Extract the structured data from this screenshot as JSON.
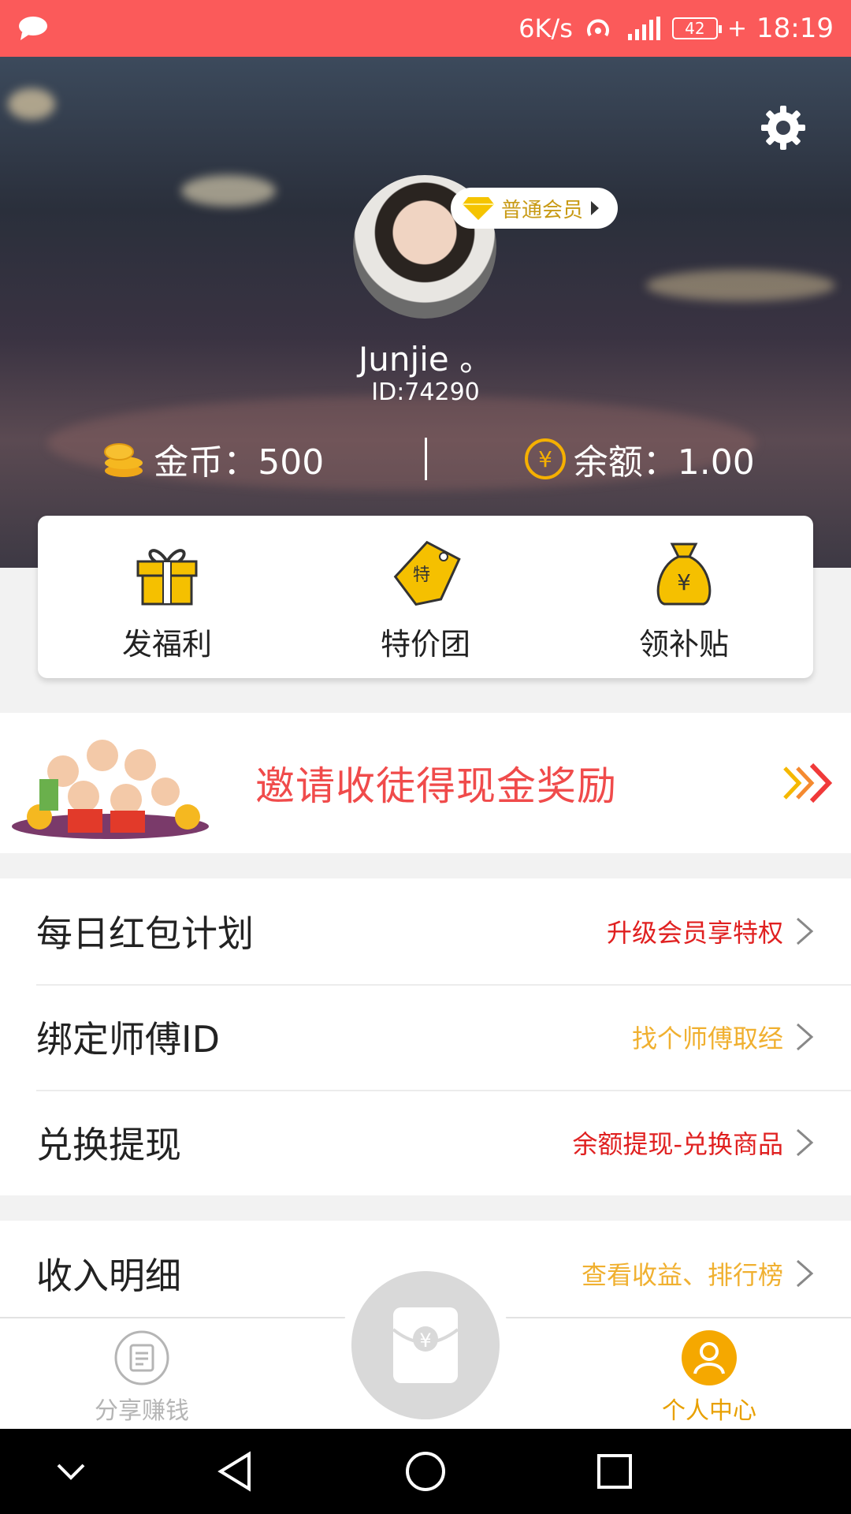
{
  "status_bar": {
    "speed": "6K/s",
    "battery": "42",
    "time": "18:19"
  },
  "profile": {
    "member_badge": "普通会员",
    "username": "Junjie 。",
    "user_id": "ID:74290",
    "coins": "金币：500",
    "balance": "余额：1.00"
  },
  "quick_actions": [
    {
      "label": "发福利",
      "icon": "gift-icon"
    },
    {
      "label": "特价团",
      "icon": "price-tag-icon"
    },
    {
      "label": "领补贴",
      "icon": "money-bag-icon"
    }
  ],
  "invite_banner": {
    "text": "邀请收徒得现金奖励"
  },
  "menu": [
    {
      "title": "每日红包计划",
      "hint": "升级会员享特权",
      "hint_color": "#e02020"
    },
    {
      "title": "绑定师傅ID",
      "hint": "找个师傅取经",
      "hint_color": "#f0b030"
    },
    {
      "title": "兑换提现",
      "hint": "余额提现-兑换商品",
      "hint_color": "#e02020"
    },
    {
      "title": "收入明细",
      "hint": "查看收益、排行榜",
      "hint_color": "#f0b030"
    }
  ],
  "tabbar": {
    "share_label": "分享赚钱",
    "profile_label": "个人中心"
  },
  "colors": {
    "status_bar": "#fb5a5a",
    "accent_gold": "#f5b800",
    "invite_red": "#f04b4b"
  }
}
